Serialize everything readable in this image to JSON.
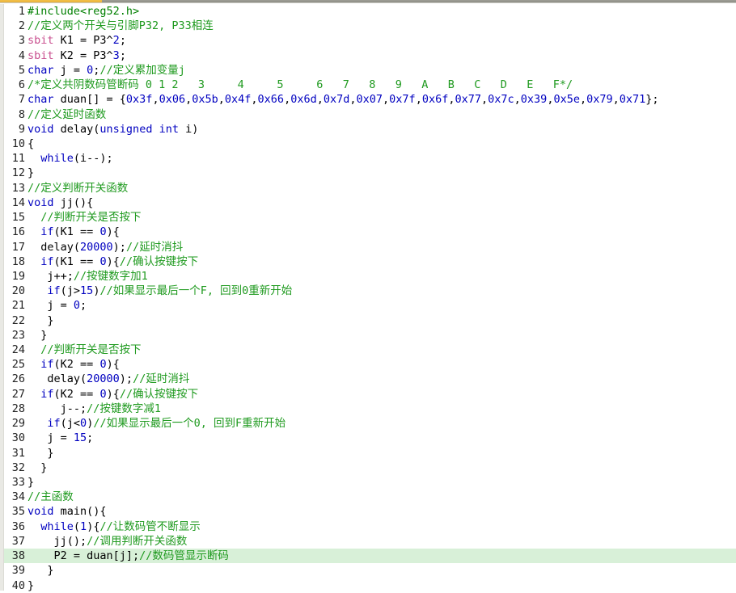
{
  "window": {
    "title": "Keil C51 source code listing",
    "topbar": {
      "accent_color": "#e8b23a",
      "secondary_color": "#8c8c84"
    }
  },
  "editor": {
    "language": "C",
    "highlighted_line": 38,
    "highlight_color": "#d8f0d8",
    "total_lines": 40,
    "colors": {
      "keyword": "#0000c0",
      "sbit_keyword": "#c94f8f",
      "preprocessor": "#007f00",
      "comment": "#1f9a1f",
      "number": "#0000c0",
      "plain": "#000000"
    },
    "lines": [
      {
        "n": "1",
        "text": "#include<reg52.h>"
      },
      {
        "n": "2",
        "text": "//定义两个开关与引脚P32, P33相连"
      },
      {
        "n": "3",
        "text": "sbit K1 = P3^2;"
      },
      {
        "n": "4",
        "text": "sbit K2 = P3^3;"
      },
      {
        "n": "5",
        "text": "char j = 0;//定义累加变量j"
      },
      {
        "n": "6",
        "text": "/*定义共阴数码管断码 0 1 2   3     4     5     6   7   8   9   A   B   C   D   E   F*/"
      },
      {
        "n": "7",
        "text": "char duan[] = {0x3f,0x06,0x5b,0x4f,0x66,0x6d,0x7d,0x07,0x7f,0x6f,0x77,0x7c,0x39,0x5e,0x79,0x71};"
      },
      {
        "n": "8",
        "text": "//定义延时函数"
      },
      {
        "n": "9",
        "text": "void delay(unsigned int i)"
      },
      {
        "n": "10",
        "text": "{"
      },
      {
        "n": "11",
        "text": "  while(i--);"
      },
      {
        "n": "12",
        "text": "}"
      },
      {
        "n": "13",
        "text": "//定义判断开关函数"
      },
      {
        "n": "14",
        "text": "void jj(){"
      },
      {
        "n": "15",
        "text": "  //判断开关是否按下"
      },
      {
        "n": "16",
        "text": "  if(K1 == 0){"
      },
      {
        "n": "17",
        "text": "  delay(20000);//延时消抖"
      },
      {
        "n": "18",
        "text": "  if(K1 == 0){//确认按键按下"
      },
      {
        "n": "19",
        "text": "   j++;//按键数字加1"
      },
      {
        "n": "20",
        "text": "   if(j>15)//如果显示最后一个F, 回到0重新开始"
      },
      {
        "n": "21",
        "text": "   j = 0;"
      },
      {
        "n": "22",
        "text": "   }"
      },
      {
        "n": "23",
        "text": "  }"
      },
      {
        "n": "24",
        "text": "  //判断开关是否按下"
      },
      {
        "n": "25",
        "text": "  if(K2 == 0){"
      },
      {
        "n": "26",
        "text": "   delay(20000);//延时消抖"
      },
      {
        "n": "27",
        "text": "  if(K2 == 0){//确认按键按下"
      },
      {
        "n": "28",
        "text": "     j--;//按键数字减1"
      },
      {
        "n": "29",
        "text": "   if(j<0)//如果显示最后一个0, 回到F重新开始"
      },
      {
        "n": "30",
        "text": "   j = 15;"
      },
      {
        "n": "31",
        "text": "   }"
      },
      {
        "n": "32",
        "text": "  }"
      },
      {
        "n": "33",
        "text": "}"
      },
      {
        "n": "34",
        "text": "//主函数"
      },
      {
        "n": "35",
        "text": "void main(){"
      },
      {
        "n": "36",
        "text": "  while(1){//让数码管不断显示"
      },
      {
        "n": "37",
        "text": "    jj();//调用判断开关函数"
      },
      {
        "n": "38",
        "text": "    P2 = duan[j];//数码管显示断码"
      },
      {
        "n": "39",
        "text": "   }"
      },
      {
        "n": "40",
        "text": "}"
      }
    ],
    "tokens": [
      [
        {
          "c": "t-pre",
          "s": "#include<reg52.h>"
        }
      ],
      [
        {
          "c": "t-cmt",
          "s": "//定义两个开关与引脚P32, P33相连"
        }
      ],
      [
        {
          "c": "t-sbit",
          "s": "sbit"
        },
        {
          "c": "t-plain",
          "s": " K1 = P3^"
        },
        {
          "c": "t-num",
          "s": "2"
        },
        {
          "c": "t-plain",
          "s": ";"
        }
      ],
      [
        {
          "c": "t-sbit",
          "s": "sbit"
        },
        {
          "c": "t-plain",
          "s": " K2 = P3^"
        },
        {
          "c": "t-num",
          "s": "3"
        },
        {
          "c": "t-plain",
          "s": ";"
        }
      ],
      [
        {
          "c": "t-kw",
          "s": "char"
        },
        {
          "c": "t-plain",
          "s": " j = "
        },
        {
          "c": "t-num",
          "s": "0"
        },
        {
          "c": "t-plain",
          "s": ";"
        },
        {
          "c": "t-cmt",
          "s": "//定义累加变量j"
        }
      ],
      [
        {
          "c": "t-cmt",
          "s": "/*定义共阴数码管断码 0 1 2   3     4     5     6   7   8   9   A   B   C   D   E   F*/"
        }
      ],
      [
        {
          "c": "t-kw",
          "s": "char"
        },
        {
          "c": "t-plain",
          "s": " duan[] = {"
        },
        {
          "c": "t-num",
          "s": "0x3f"
        },
        {
          "c": "t-plain",
          "s": ","
        },
        {
          "c": "t-num",
          "s": "0x06"
        },
        {
          "c": "t-plain",
          "s": ","
        },
        {
          "c": "t-num",
          "s": "0x5b"
        },
        {
          "c": "t-plain",
          "s": ","
        },
        {
          "c": "t-num",
          "s": "0x4f"
        },
        {
          "c": "t-plain",
          "s": ","
        },
        {
          "c": "t-num",
          "s": "0x66"
        },
        {
          "c": "t-plain",
          "s": ","
        },
        {
          "c": "t-num",
          "s": "0x6d"
        },
        {
          "c": "t-plain",
          "s": ","
        },
        {
          "c": "t-num",
          "s": "0x7d"
        },
        {
          "c": "t-plain",
          "s": ","
        },
        {
          "c": "t-num",
          "s": "0x07"
        },
        {
          "c": "t-plain",
          "s": ","
        },
        {
          "c": "t-num",
          "s": "0x7f"
        },
        {
          "c": "t-plain",
          "s": ","
        },
        {
          "c": "t-num",
          "s": "0x6f"
        },
        {
          "c": "t-plain",
          "s": ","
        },
        {
          "c": "t-num",
          "s": "0x77"
        },
        {
          "c": "t-plain",
          "s": ","
        },
        {
          "c": "t-num",
          "s": "0x7c"
        },
        {
          "c": "t-plain",
          "s": ","
        },
        {
          "c": "t-num",
          "s": "0x39"
        },
        {
          "c": "t-plain",
          "s": ","
        },
        {
          "c": "t-num",
          "s": "0x5e"
        },
        {
          "c": "t-plain",
          "s": ","
        },
        {
          "c": "t-num",
          "s": "0x79"
        },
        {
          "c": "t-plain",
          "s": ","
        },
        {
          "c": "t-num",
          "s": "0x71"
        },
        {
          "c": "t-plain",
          "s": "};"
        }
      ],
      [
        {
          "c": "t-cmt",
          "s": "//定义延时函数"
        }
      ],
      [
        {
          "c": "t-kw",
          "s": "void"
        },
        {
          "c": "t-plain",
          "s": " delay("
        },
        {
          "c": "t-kw",
          "s": "unsigned int"
        },
        {
          "c": "t-plain",
          "s": " i)"
        }
      ],
      [
        {
          "c": "t-plain",
          "s": "{"
        }
      ],
      [
        {
          "c": "t-plain",
          "s": "  "
        },
        {
          "c": "t-kw",
          "s": "while"
        },
        {
          "c": "t-plain",
          "s": "(i--);"
        }
      ],
      [
        {
          "c": "t-plain",
          "s": "}"
        }
      ],
      [
        {
          "c": "t-cmt",
          "s": "//定义判断开关函数"
        }
      ],
      [
        {
          "c": "t-kw",
          "s": "void"
        },
        {
          "c": "t-plain",
          "s": " jj(){"
        }
      ],
      [
        {
          "c": "t-plain",
          "s": "  "
        },
        {
          "c": "t-cmt",
          "s": "//判断开关是否按下"
        }
      ],
      [
        {
          "c": "t-plain",
          "s": "  "
        },
        {
          "c": "t-kw",
          "s": "if"
        },
        {
          "c": "t-plain",
          "s": "(K1 == "
        },
        {
          "c": "t-num",
          "s": "0"
        },
        {
          "c": "t-plain",
          "s": "){"
        }
      ],
      [
        {
          "c": "t-plain",
          "s": "  delay("
        },
        {
          "c": "t-num",
          "s": "20000"
        },
        {
          "c": "t-plain",
          "s": ");"
        },
        {
          "c": "t-cmt",
          "s": "//延时消抖"
        }
      ],
      [
        {
          "c": "t-plain",
          "s": "  "
        },
        {
          "c": "t-kw",
          "s": "if"
        },
        {
          "c": "t-plain",
          "s": "(K1 == "
        },
        {
          "c": "t-num",
          "s": "0"
        },
        {
          "c": "t-plain",
          "s": "){"
        },
        {
          "c": "t-cmt",
          "s": "//确认按键按下"
        }
      ],
      [
        {
          "c": "t-plain",
          "s": "   j++;"
        },
        {
          "c": "t-cmt",
          "s": "//按键数字加1"
        }
      ],
      [
        {
          "c": "t-plain",
          "s": "   "
        },
        {
          "c": "t-kw",
          "s": "if"
        },
        {
          "c": "t-plain",
          "s": "(j>"
        },
        {
          "c": "t-num",
          "s": "15"
        },
        {
          "c": "t-plain",
          "s": ")"
        },
        {
          "c": "t-cmt",
          "s": "//如果显示最后一个F, 回到0重新开始"
        }
      ],
      [
        {
          "c": "t-plain",
          "s": "   j = "
        },
        {
          "c": "t-num",
          "s": "0"
        },
        {
          "c": "t-plain",
          "s": ";"
        }
      ],
      [
        {
          "c": "t-plain",
          "s": "   }"
        }
      ],
      [
        {
          "c": "t-plain",
          "s": "  }"
        }
      ],
      [
        {
          "c": "t-plain",
          "s": "  "
        },
        {
          "c": "t-cmt",
          "s": "//判断开关是否按下"
        }
      ],
      [
        {
          "c": "t-plain",
          "s": "  "
        },
        {
          "c": "t-kw",
          "s": "if"
        },
        {
          "c": "t-plain",
          "s": "(K2 == "
        },
        {
          "c": "t-num",
          "s": "0"
        },
        {
          "c": "t-plain",
          "s": "){"
        }
      ],
      [
        {
          "c": "t-plain",
          "s": "   delay("
        },
        {
          "c": "t-num",
          "s": "20000"
        },
        {
          "c": "t-plain",
          "s": ");"
        },
        {
          "c": "t-cmt",
          "s": "//延时消抖"
        }
      ],
      [
        {
          "c": "t-plain",
          "s": "  "
        },
        {
          "c": "t-kw",
          "s": "if"
        },
        {
          "c": "t-plain",
          "s": "(K2 == "
        },
        {
          "c": "t-num",
          "s": "0"
        },
        {
          "c": "t-plain",
          "s": "){"
        },
        {
          "c": "t-cmt",
          "s": "//确认按键按下"
        }
      ],
      [
        {
          "c": "t-plain",
          "s": "     j--;"
        },
        {
          "c": "t-cmt",
          "s": "//按键数字减1"
        }
      ],
      [
        {
          "c": "t-plain",
          "s": "   "
        },
        {
          "c": "t-kw",
          "s": "if"
        },
        {
          "c": "t-plain",
          "s": "(j<"
        },
        {
          "c": "t-num",
          "s": "0"
        },
        {
          "c": "t-plain",
          "s": ")"
        },
        {
          "c": "t-cmt",
          "s": "//如果显示最后一个0, 回到F重新开始"
        }
      ],
      [
        {
          "c": "t-plain",
          "s": "   j = "
        },
        {
          "c": "t-num",
          "s": "15"
        },
        {
          "c": "t-plain",
          "s": ";"
        }
      ],
      [
        {
          "c": "t-plain",
          "s": "   }"
        }
      ],
      [
        {
          "c": "t-plain",
          "s": "  }"
        }
      ],
      [
        {
          "c": "t-plain",
          "s": "}"
        }
      ],
      [
        {
          "c": "t-cmt",
          "s": "//主函数"
        }
      ],
      [
        {
          "c": "t-kw",
          "s": "void"
        },
        {
          "c": "t-plain",
          "s": " main(){"
        }
      ],
      [
        {
          "c": "t-plain",
          "s": "  "
        },
        {
          "c": "t-kw",
          "s": "while"
        },
        {
          "c": "t-plain",
          "s": "("
        },
        {
          "c": "t-num",
          "s": "1"
        },
        {
          "c": "t-plain",
          "s": "){"
        },
        {
          "c": "t-cmt",
          "s": "//让数码管不断显示"
        }
      ],
      [
        {
          "c": "t-plain",
          "s": "    jj();"
        },
        {
          "c": "t-cmt",
          "s": "//调用判断开关函数"
        }
      ],
      [
        {
          "c": "t-plain",
          "s": "    P2 = duan[j];"
        },
        {
          "c": "t-cmt",
          "s": "//数码管显示断码"
        }
      ],
      [
        {
          "c": "t-plain",
          "s": "   }"
        }
      ],
      [
        {
          "c": "t-plain",
          "s": "}"
        }
      ]
    ]
  }
}
